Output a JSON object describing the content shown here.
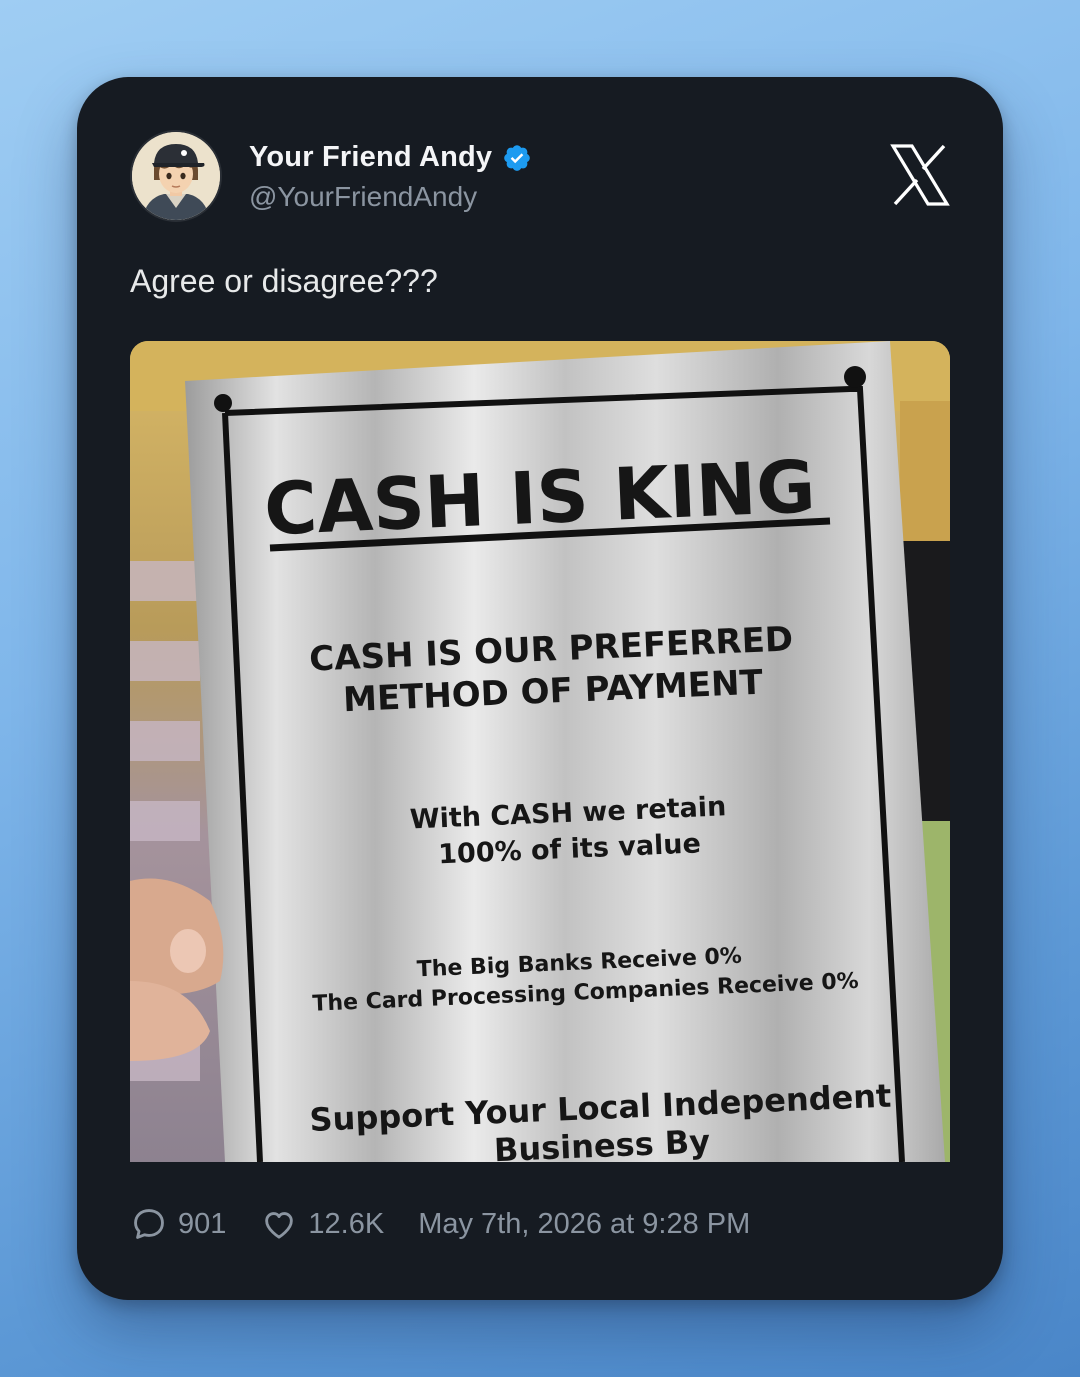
{
  "author": {
    "name": "Your Friend Andy",
    "handle": "@YourFriendAndy",
    "verified": true,
    "avatar_icon": "cartoon-avatar-icon"
  },
  "platform_icon": "x-logo-icon",
  "tweet": {
    "text": "Agree or disagree???"
  },
  "media": {
    "sign_title": "CASH IS KING",
    "sign_line_1": "CASH IS OUR PREFERRED",
    "sign_line_2": "METHOD OF PAYMENT",
    "sign_line_3": "With CASH we retain",
    "sign_line_4": "100% of its value",
    "sign_line_5": "The Big Banks Receive 0%",
    "sign_line_6": "The Card Processing Companies Receive 0%",
    "sign_line_7": "Support Your Local Independent",
    "sign_line_8": "Business By"
  },
  "stats": {
    "replies": "901",
    "likes": "12.6K",
    "timestamp": "May 7th, 2026 at 9:28 PM"
  },
  "colors": {
    "card_bg": "#161b22",
    "verified_blue": "#1d9bf0",
    "muted_text": "#8b95a1"
  }
}
